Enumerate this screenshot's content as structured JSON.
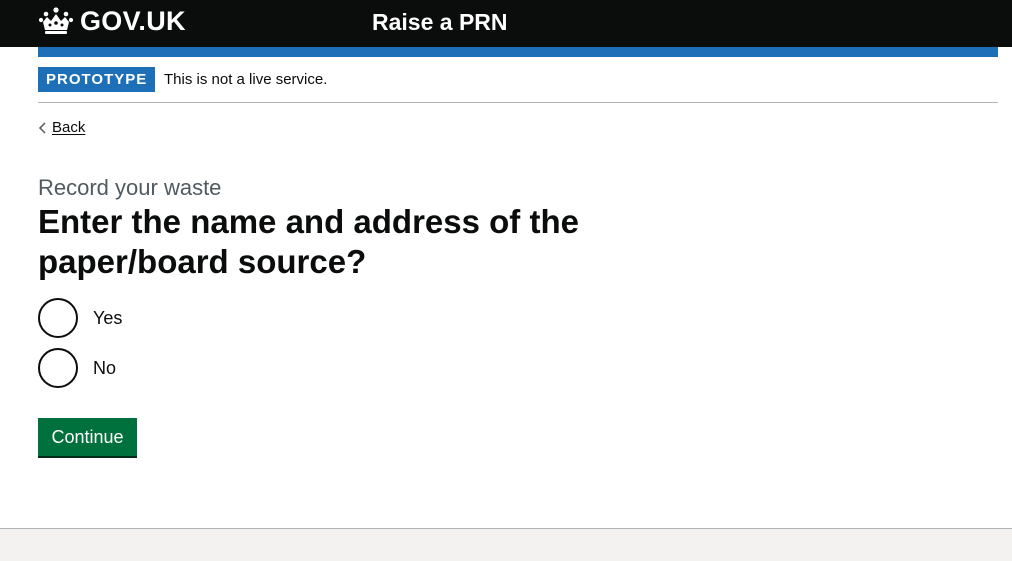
{
  "header": {
    "logo_text": "GOV.UK",
    "service_name": "Raise a PRN",
    "logo_icon": "crown-icon"
  },
  "phase_banner": {
    "tag": "PROTOTYPE",
    "text": "This is not a live service."
  },
  "back_link": {
    "label": "Back",
    "icon": "chevron-left-icon"
  },
  "form": {
    "caption": "Record your waste",
    "heading": "Enter the name and address of the paper/board source?",
    "options": [
      {
        "label": "Yes",
        "selected": false
      },
      {
        "label": "No",
        "selected": false
      }
    ],
    "submit_label": "Continue"
  },
  "colors": {
    "header_bg": "#0b0c0c",
    "brand_blue": "#1d70b8",
    "button_green": "#00703c",
    "caption_grey": "#505a5f",
    "footer_bg": "#f3f2f1"
  }
}
